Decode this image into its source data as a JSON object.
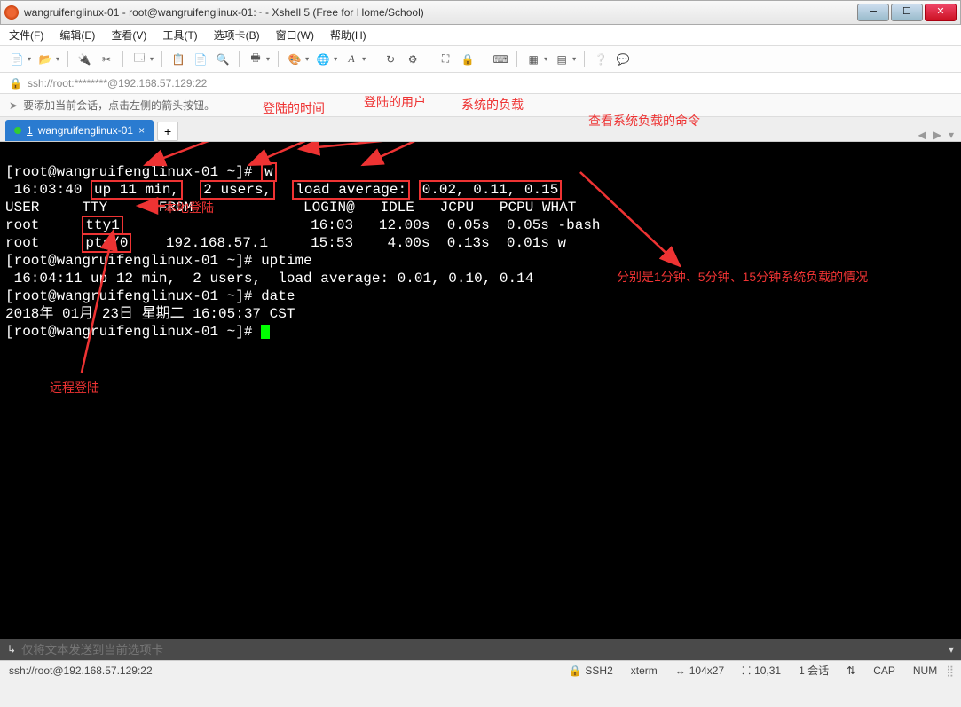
{
  "window": {
    "title": "wangruifenglinux-01 - root@wangruifenglinux-01:~ - Xshell 5 (Free for Home/School)"
  },
  "menu": {
    "file": "文件(F)",
    "edit": "编辑(E)",
    "view": "查看(V)",
    "tools": "工具(T)",
    "tabs": "选项卡(B)",
    "window": "窗口(W)",
    "help": "帮助(H)"
  },
  "address": {
    "text": "ssh://root:********@192.168.57.129:22"
  },
  "hint": {
    "text": "要添加当前会话，点击左侧的箭头按钮。"
  },
  "tab": {
    "index": "1",
    "label": "wangruifenglinux-01"
  },
  "annotations": {
    "login_time": "登陆的时间",
    "login_user": "登陆的用户",
    "system_load": "系统的负载",
    "load_cmd": "查看系统负载的命令",
    "local_login": "本地登陆",
    "remote_login": "远程登陆",
    "load_explain": "分别是1分钟、5分钟、15分钟系统负载的情况"
  },
  "terminal": {
    "prompt": "[root@wangruifenglinux-01 ~]#",
    "cmd_w": "w",
    "w_line1": " 16:03:40 up 11 min,  2 users,  load average: 0.02, 0.11, 0.15",
    "w_header": "USER     TTY      FROM             LOGIN@   IDLE   JCPU   PCPU WHAT",
    "w_row1": "root     tty1                      16:03   12.00s  0.05s  0.05s -bash",
    "w_row2": "root     pts/0    192.168.57.1     15:53    4.00s  0.13s  0.01s w",
    "cmd_uptime": "uptime",
    "uptime_out": " 16:04:11 up 12 min,  2 users,  load average: 0.01, 0.10, 0.14",
    "cmd_date": "date",
    "date_out": "2018年 01月 23日 星期二 16:05:37 CST",
    "boxed": {
      "up11": "up 11 min,",
      "users2": "2 users,",
      "loadavg": "load average:",
      "loadnums": "0.02, 0.11, 0.15",
      "tty1": "tty1",
      "pts0": "pts/0",
      "wbox": "w"
    }
  },
  "sendbar": {
    "placeholder": "仅将文本发送到当前选项卡"
  },
  "status": {
    "ssh_url": "ssh://root@192.168.57.129:22",
    "protocol": "SSH2",
    "term": "xterm",
    "size": "104x27",
    "pos": "10,31",
    "sessions": "1 会话",
    "cap": "CAP",
    "num": "NUM"
  },
  "colors": {
    "annotation": "#e33",
    "tab_bg": "#2a7bd0"
  }
}
